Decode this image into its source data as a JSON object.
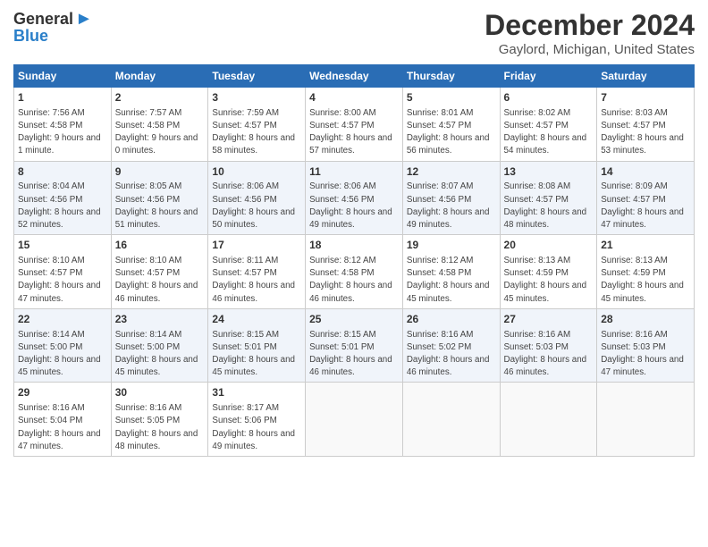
{
  "logo": {
    "general": "General",
    "blue": "Blue",
    "arrow": "▶"
  },
  "title": "December 2024",
  "subtitle": "Gaylord, Michigan, United States",
  "headers": [
    "Sunday",
    "Monday",
    "Tuesday",
    "Wednesday",
    "Thursday",
    "Friday",
    "Saturday"
  ],
  "weeks": [
    [
      {
        "day": "1",
        "sunrise": "Sunrise: 7:56 AM",
        "sunset": "Sunset: 4:58 PM",
        "daylight": "Daylight: 9 hours and 1 minute."
      },
      {
        "day": "2",
        "sunrise": "Sunrise: 7:57 AM",
        "sunset": "Sunset: 4:58 PM",
        "daylight": "Daylight: 9 hours and 0 minutes."
      },
      {
        "day": "3",
        "sunrise": "Sunrise: 7:59 AM",
        "sunset": "Sunset: 4:57 PM",
        "daylight": "Daylight: 8 hours and 58 minutes."
      },
      {
        "day": "4",
        "sunrise": "Sunrise: 8:00 AM",
        "sunset": "Sunset: 4:57 PM",
        "daylight": "Daylight: 8 hours and 57 minutes."
      },
      {
        "day": "5",
        "sunrise": "Sunrise: 8:01 AM",
        "sunset": "Sunset: 4:57 PM",
        "daylight": "Daylight: 8 hours and 56 minutes."
      },
      {
        "day": "6",
        "sunrise": "Sunrise: 8:02 AM",
        "sunset": "Sunset: 4:57 PM",
        "daylight": "Daylight: 8 hours and 54 minutes."
      },
      {
        "day": "7",
        "sunrise": "Sunrise: 8:03 AM",
        "sunset": "Sunset: 4:57 PM",
        "daylight": "Daylight: 8 hours and 53 minutes."
      }
    ],
    [
      {
        "day": "8",
        "sunrise": "Sunrise: 8:04 AM",
        "sunset": "Sunset: 4:56 PM",
        "daylight": "Daylight: 8 hours and 52 minutes."
      },
      {
        "day": "9",
        "sunrise": "Sunrise: 8:05 AM",
        "sunset": "Sunset: 4:56 PM",
        "daylight": "Daylight: 8 hours and 51 minutes."
      },
      {
        "day": "10",
        "sunrise": "Sunrise: 8:06 AM",
        "sunset": "Sunset: 4:56 PM",
        "daylight": "Daylight: 8 hours and 50 minutes."
      },
      {
        "day": "11",
        "sunrise": "Sunrise: 8:06 AM",
        "sunset": "Sunset: 4:56 PM",
        "daylight": "Daylight: 8 hours and 49 minutes."
      },
      {
        "day": "12",
        "sunrise": "Sunrise: 8:07 AM",
        "sunset": "Sunset: 4:56 PM",
        "daylight": "Daylight: 8 hours and 49 minutes."
      },
      {
        "day": "13",
        "sunrise": "Sunrise: 8:08 AM",
        "sunset": "Sunset: 4:57 PM",
        "daylight": "Daylight: 8 hours and 48 minutes."
      },
      {
        "day": "14",
        "sunrise": "Sunrise: 8:09 AM",
        "sunset": "Sunset: 4:57 PM",
        "daylight": "Daylight: 8 hours and 47 minutes."
      }
    ],
    [
      {
        "day": "15",
        "sunrise": "Sunrise: 8:10 AM",
        "sunset": "Sunset: 4:57 PM",
        "daylight": "Daylight: 8 hours and 47 minutes."
      },
      {
        "day": "16",
        "sunrise": "Sunrise: 8:10 AM",
        "sunset": "Sunset: 4:57 PM",
        "daylight": "Daylight: 8 hours and 46 minutes."
      },
      {
        "day": "17",
        "sunrise": "Sunrise: 8:11 AM",
        "sunset": "Sunset: 4:57 PM",
        "daylight": "Daylight: 8 hours and 46 minutes."
      },
      {
        "day": "18",
        "sunrise": "Sunrise: 8:12 AM",
        "sunset": "Sunset: 4:58 PM",
        "daylight": "Daylight: 8 hours and 46 minutes."
      },
      {
        "day": "19",
        "sunrise": "Sunrise: 8:12 AM",
        "sunset": "Sunset: 4:58 PM",
        "daylight": "Daylight: 8 hours and 45 minutes."
      },
      {
        "day": "20",
        "sunrise": "Sunrise: 8:13 AM",
        "sunset": "Sunset: 4:59 PM",
        "daylight": "Daylight: 8 hours and 45 minutes."
      },
      {
        "day": "21",
        "sunrise": "Sunrise: 8:13 AM",
        "sunset": "Sunset: 4:59 PM",
        "daylight": "Daylight: 8 hours and 45 minutes."
      }
    ],
    [
      {
        "day": "22",
        "sunrise": "Sunrise: 8:14 AM",
        "sunset": "Sunset: 5:00 PM",
        "daylight": "Daylight: 8 hours and 45 minutes."
      },
      {
        "day": "23",
        "sunrise": "Sunrise: 8:14 AM",
        "sunset": "Sunset: 5:00 PM",
        "daylight": "Daylight: 8 hours and 45 minutes."
      },
      {
        "day": "24",
        "sunrise": "Sunrise: 8:15 AM",
        "sunset": "Sunset: 5:01 PM",
        "daylight": "Daylight: 8 hours and 45 minutes."
      },
      {
        "day": "25",
        "sunrise": "Sunrise: 8:15 AM",
        "sunset": "Sunset: 5:01 PM",
        "daylight": "Daylight: 8 hours and 46 minutes."
      },
      {
        "day": "26",
        "sunrise": "Sunrise: 8:16 AM",
        "sunset": "Sunset: 5:02 PM",
        "daylight": "Daylight: 8 hours and 46 minutes."
      },
      {
        "day": "27",
        "sunrise": "Sunrise: 8:16 AM",
        "sunset": "Sunset: 5:03 PM",
        "daylight": "Daylight: 8 hours and 46 minutes."
      },
      {
        "day": "28",
        "sunrise": "Sunrise: 8:16 AM",
        "sunset": "Sunset: 5:03 PM",
        "daylight": "Daylight: 8 hours and 47 minutes."
      }
    ],
    [
      {
        "day": "29",
        "sunrise": "Sunrise: 8:16 AM",
        "sunset": "Sunset: 5:04 PM",
        "daylight": "Daylight: 8 hours and 47 minutes."
      },
      {
        "day": "30",
        "sunrise": "Sunrise: 8:16 AM",
        "sunset": "Sunset: 5:05 PM",
        "daylight": "Daylight: 8 hours and 48 minutes."
      },
      {
        "day": "31",
        "sunrise": "Sunrise: 8:17 AM",
        "sunset": "Sunset: 5:06 PM",
        "daylight": "Daylight: 8 hours and 49 minutes."
      },
      null,
      null,
      null,
      null
    ]
  ]
}
